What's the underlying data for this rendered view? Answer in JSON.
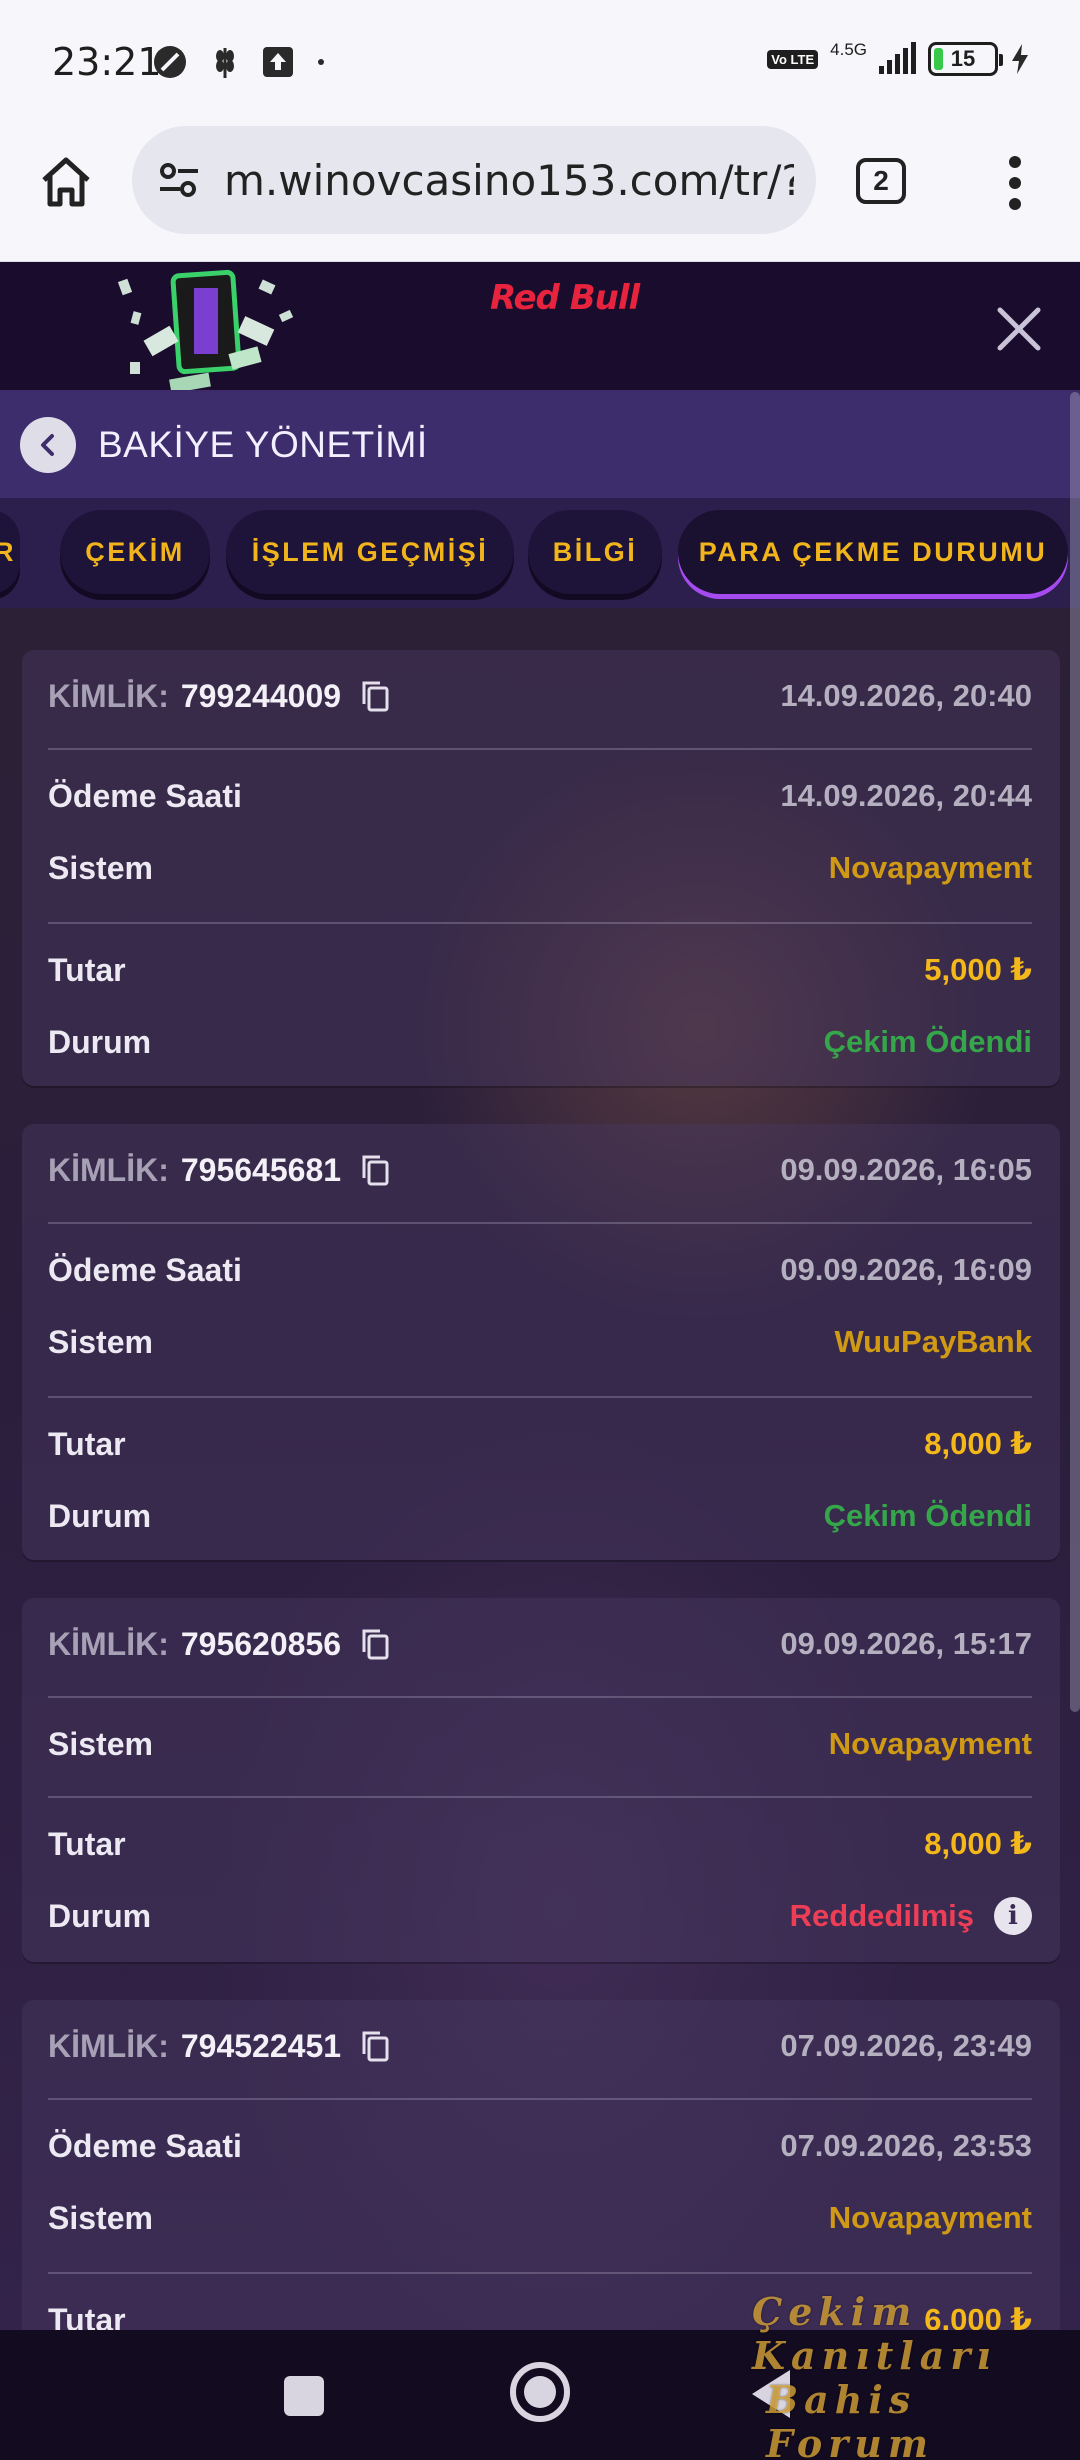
{
  "status_bar": {
    "time": "23:21",
    "network": "4.5G",
    "volte": "Vo LTE",
    "battery": "15",
    "battery_level": 0.15
  },
  "browser": {
    "url": "m.winovcasino153.com/tr/?pr",
    "tab_count": "2"
  },
  "banner": {
    "logo_text": "Red Bull"
  },
  "header": {
    "title": "BAKİYE YÖNETİMİ"
  },
  "tabs": [
    {
      "label": "R",
      "active": false
    },
    {
      "label": "ÇEKİM",
      "active": false
    },
    {
      "label": "İŞLEM GEÇMİŞİ",
      "active": false
    },
    {
      "label": "BİLGİ",
      "active": false
    },
    {
      "label": "PARA ÇEKME DURUMU",
      "active": true
    }
  ],
  "labels": {
    "id": "KİMLİK:",
    "payment_time": "Ödeme Saati",
    "system": "Sistem",
    "amount": "Tutar",
    "status": "Durum"
  },
  "transactions": [
    {
      "id": "799244009",
      "date": "14.09.2026, 20:40",
      "payment_time": "14.09.2026, 20:44",
      "system": "Novapayment",
      "amount": "5,000 ₺",
      "status": "Çekim Ödendi"
    },
    {
      "id": "795645681",
      "date": "09.09.2026, 16:05",
      "payment_time": "09.09.2026, 16:09",
      "system": "WuuPayBank",
      "amount": "8,000 ₺",
      "status": "Çekim Ödendi"
    },
    {
      "id": "795620856",
      "date": "09.09.2026, 15:17",
      "system": "Novapayment",
      "amount": "8,000 ₺",
      "status": "Reddedilmiş"
    },
    {
      "id": "794522451",
      "date": "07.09.2026, 23:49",
      "payment_time": "07.09.2026, 23:53",
      "system": "Novapayment",
      "amount": "6,000 ₺"
    }
  ],
  "watermark": {
    "line1": "Çekim Kanıtları",
    "line2": "Bahis Forum"
  },
  "colors": {
    "accent_gold": "#f5b81a",
    "paid_green": "#35a64a",
    "rejected_red": "#ee3e56",
    "header_purple": "#3e2d6c"
  }
}
